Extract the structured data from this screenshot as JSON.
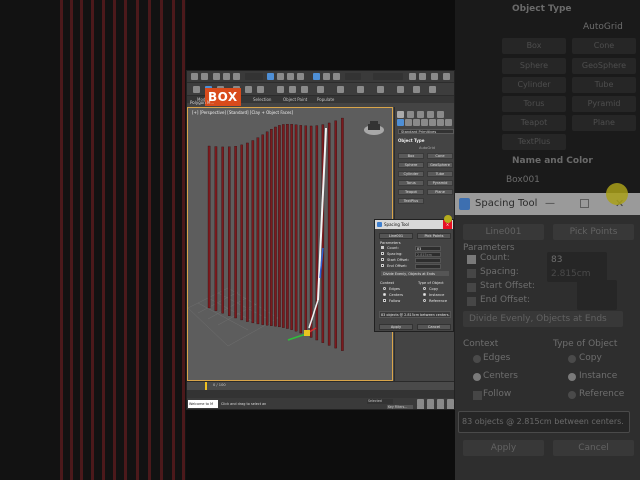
{
  "badge": {
    "text": "BOX"
  },
  "viewport": {
    "label": "[+] [Perspective] [Standard] [Clay + Object Faces]"
  },
  "ribbon": {
    "tabs": [
      "Modeling",
      "Selection",
      "Object Paint",
      "Populate"
    ],
    "mode_label": "Polygon M..."
  },
  "command_panel": {
    "category": "Standard Primitives",
    "section_object_type": "Object Type",
    "autogrid": "AutoGrid",
    "buttons": [
      "Box",
      "Cone",
      "Sphere",
      "GeoSphere",
      "Cylinder",
      "Tube",
      "Torus",
      "Pyramid",
      "Teapot",
      "Plane",
      "TextPlus"
    ],
    "section_name_color": "Name and Color",
    "object_name": "Box001"
  },
  "spacing_tool": {
    "title": "Spacing Tool",
    "pick_path": "Line001",
    "pick_points": "Pick Points",
    "parameters": "Parameters",
    "count_label": "Count:",
    "count_value": "83",
    "spacing_label": "Spacing:",
    "spacing_value": "2.815cm",
    "start_offset_label": "Start Offset:",
    "end_offset_label": "End Offset:",
    "distribution": "Divide Evenly, Objects at Ends",
    "context_label": "Context",
    "context_options": [
      "Edges",
      "Centers",
      "Follow"
    ],
    "context_selected": "Centers",
    "type_label": "Type of Object",
    "type_options": [
      "Copy",
      "Instance",
      "Reference"
    ],
    "type_selected": "Instance",
    "info": "83 objects @ 2.815cm  between centers.",
    "apply": "Apply",
    "cancel": "Cancel"
  },
  "status": {
    "frame": "0 / 100",
    "script_hint": "Welcome to M",
    "prompt": "Click and drag to select an",
    "selection_set": "Selected",
    "key_filters": "Key Filters..."
  },
  "colors": {
    "badge_bg": "#d94b1c",
    "viewport_border": "#d9a54a",
    "curtain_strip": "#7a1a1e",
    "accent_blue": "#4e8fd6"
  }
}
